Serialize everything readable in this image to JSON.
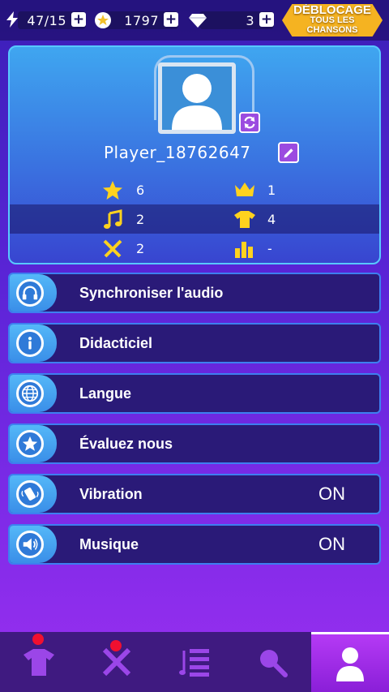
{
  "top_bar": {
    "energy": "47/15",
    "coins": "1797",
    "diamonds": "3",
    "unlock_line1": "DÉBLOCAGE",
    "unlock_line2": "TOUS LES",
    "unlock_line3": "CHANSONS",
    "colors": {
      "unlock": "#f5b321",
      "pill": "#1c1160"
    }
  },
  "profile": {
    "player_name": "Player_18762647",
    "stats": [
      {
        "icon": "star-icon",
        "value": "6"
      },
      {
        "icon": "crown-icon",
        "value": "1"
      },
      {
        "icon": "music-note-icon",
        "value": "2"
      },
      {
        "icon": "shirt-icon",
        "value": "4"
      },
      {
        "icon": "swords-icon",
        "value": "2"
      },
      {
        "icon": "bar-chart-icon",
        "value": "--"
      }
    ]
  },
  "menu": [
    {
      "icon": "headphones-icon",
      "label": "Synchroniser l'audio",
      "value": ""
    },
    {
      "icon": "info-icon",
      "label": "Didacticiel",
      "value": ""
    },
    {
      "icon": "globe-icon",
      "label": "Langue",
      "value": ""
    },
    {
      "icon": "star-icon",
      "label": "Évaluez nous",
      "value": ""
    },
    {
      "icon": "vibration-icon",
      "label": "Vibration",
      "value": "ON"
    },
    {
      "icon": "speaker-icon",
      "label": "Musique",
      "value": "ON"
    }
  ],
  "bottom_nav": [
    {
      "icon": "shirt-icon",
      "badge": true,
      "active": false
    },
    {
      "icon": "swords-icon",
      "badge": true,
      "active": false
    },
    {
      "icon": "song-list-icon",
      "badge": false,
      "active": false
    },
    {
      "icon": "search-icon",
      "badge": false,
      "active": false
    },
    {
      "icon": "profile-icon",
      "badge": false,
      "active": true
    }
  ]
}
